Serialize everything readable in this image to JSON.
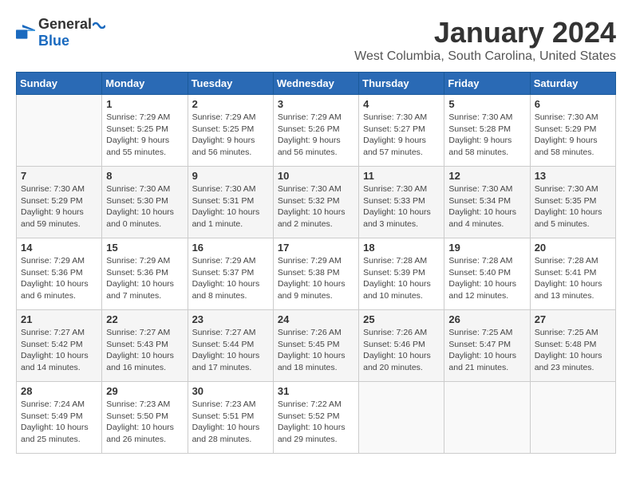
{
  "header": {
    "logo_general": "General",
    "logo_blue": "Blue",
    "month_title": "January 2024",
    "subtitle": "West Columbia, South Carolina, United States"
  },
  "days_of_week": [
    "Sunday",
    "Monday",
    "Tuesday",
    "Wednesday",
    "Thursday",
    "Friday",
    "Saturday"
  ],
  "weeks": [
    [
      {
        "day": "",
        "info": ""
      },
      {
        "day": "1",
        "info": "Sunrise: 7:29 AM\nSunset: 5:25 PM\nDaylight: 9 hours\nand 55 minutes."
      },
      {
        "day": "2",
        "info": "Sunrise: 7:29 AM\nSunset: 5:25 PM\nDaylight: 9 hours\nand 56 minutes."
      },
      {
        "day": "3",
        "info": "Sunrise: 7:29 AM\nSunset: 5:26 PM\nDaylight: 9 hours\nand 56 minutes."
      },
      {
        "day": "4",
        "info": "Sunrise: 7:30 AM\nSunset: 5:27 PM\nDaylight: 9 hours\nand 57 minutes."
      },
      {
        "day": "5",
        "info": "Sunrise: 7:30 AM\nSunset: 5:28 PM\nDaylight: 9 hours\nand 58 minutes."
      },
      {
        "day": "6",
        "info": "Sunrise: 7:30 AM\nSunset: 5:29 PM\nDaylight: 9 hours\nand 58 minutes."
      }
    ],
    [
      {
        "day": "7",
        "info": "Sunrise: 7:30 AM\nSunset: 5:29 PM\nDaylight: 9 hours\nand 59 minutes."
      },
      {
        "day": "8",
        "info": "Sunrise: 7:30 AM\nSunset: 5:30 PM\nDaylight: 10 hours\nand 0 minutes."
      },
      {
        "day": "9",
        "info": "Sunrise: 7:30 AM\nSunset: 5:31 PM\nDaylight: 10 hours\nand 1 minute."
      },
      {
        "day": "10",
        "info": "Sunrise: 7:30 AM\nSunset: 5:32 PM\nDaylight: 10 hours\nand 2 minutes."
      },
      {
        "day": "11",
        "info": "Sunrise: 7:30 AM\nSunset: 5:33 PM\nDaylight: 10 hours\nand 3 minutes."
      },
      {
        "day": "12",
        "info": "Sunrise: 7:30 AM\nSunset: 5:34 PM\nDaylight: 10 hours\nand 4 minutes."
      },
      {
        "day": "13",
        "info": "Sunrise: 7:30 AM\nSunset: 5:35 PM\nDaylight: 10 hours\nand 5 minutes."
      }
    ],
    [
      {
        "day": "14",
        "info": "Sunrise: 7:29 AM\nSunset: 5:36 PM\nDaylight: 10 hours\nand 6 minutes."
      },
      {
        "day": "15",
        "info": "Sunrise: 7:29 AM\nSunset: 5:36 PM\nDaylight: 10 hours\nand 7 minutes."
      },
      {
        "day": "16",
        "info": "Sunrise: 7:29 AM\nSunset: 5:37 PM\nDaylight: 10 hours\nand 8 minutes."
      },
      {
        "day": "17",
        "info": "Sunrise: 7:29 AM\nSunset: 5:38 PM\nDaylight: 10 hours\nand 9 minutes."
      },
      {
        "day": "18",
        "info": "Sunrise: 7:28 AM\nSunset: 5:39 PM\nDaylight: 10 hours\nand 10 minutes."
      },
      {
        "day": "19",
        "info": "Sunrise: 7:28 AM\nSunset: 5:40 PM\nDaylight: 10 hours\nand 12 minutes."
      },
      {
        "day": "20",
        "info": "Sunrise: 7:28 AM\nSunset: 5:41 PM\nDaylight: 10 hours\nand 13 minutes."
      }
    ],
    [
      {
        "day": "21",
        "info": "Sunrise: 7:27 AM\nSunset: 5:42 PM\nDaylight: 10 hours\nand 14 minutes."
      },
      {
        "day": "22",
        "info": "Sunrise: 7:27 AM\nSunset: 5:43 PM\nDaylight: 10 hours\nand 16 minutes."
      },
      {
        "day": "23",
        "info": "Sunrise: 7:27 AM\nSunset: 5:44 PM\nDaylight: 10 hours\nand 17 minutes."
      },
      {
        "day": "24",
        "info": "Sunrise: 7:26 AM\nSunset: 5:45 PM\nDaylight: 10 hours\nand 18 minutes."
      },
      {
        "day": "25",
        "info": "Sunrise: 7:26 AM\nSunset: 5:46 PM\nDaylight: 10 hours\nand 20 minutes."
      },
      {
        "day": "26",
        "info": "Sunrise: 7:25 AM\nSunset: 5:47 PM\nDaylight: 10 hours\nand 21 minutes."
      },
      {
        "day": "27",
        "info": "Sunrise: 7:25 AM\nSunset: 5:48 PM\nDaylight: 10 hours\nand 23 minutes."
      }
    ],
    [
      {
        "day": "28",
        "info": "Sunrise: 7:24 AM\nSunset: 5:49 PM\nDaylight: 10 hours\nand 25 minutes."
      },
      {
        "day": "29",
        "info": "Sunrise: 7:23 AM\nSunset: 5:50 PM\nDaylight: 10 hours\nand 26 minutes."
      },
      {
        "day": "30",
        "info": "Sunrise: 7:23 AM\nSunset: 5:51 PM\nDaylight: 10 hours\nand 28 minutes."
      },
      {
        "day": "31",
        "info": "Sunrise: 7:22 AM\nSunset: 5:52 PM\nDaylight: 10 hours\nand 29 minutes."
      },
      {
        "day": "",
        "info": ""
      },
      {
        "day": "",
        "info": ""
      },
      {
        "day": "",
        "info": ""
      }
    ]
  ]
}
